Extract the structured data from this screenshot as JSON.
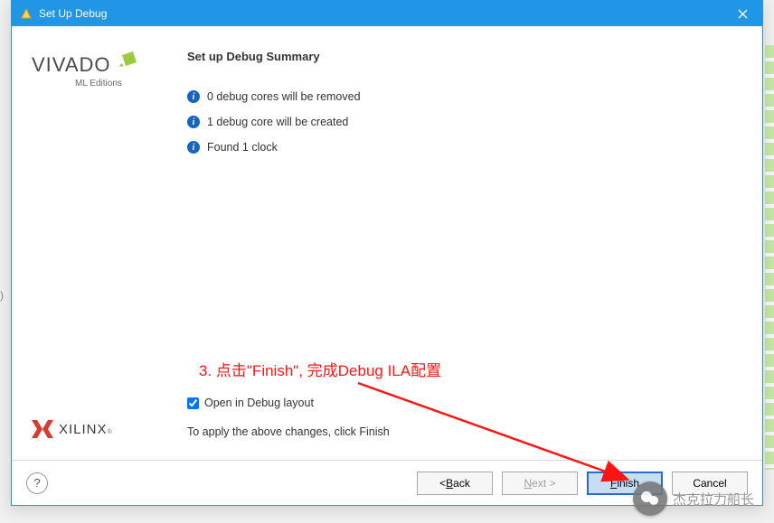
{
  "window": {
    "title": "Set Up Debug"
  },
  "sidebar": {
    "vivado_main": "VIVADO",
    "vivado_sub": "ML Editions",
    "xilinx": "XILINX"
  },
  "summary": {
    "heading": "Set up Debug Summary",
    "items": [
      "0 debug cores will be removed",
      "1 debug core will be created",
      "Found 1 clock"
    ]
  },
  "checkbox": {
    "label": "Open in Debug layout",
    "checked": true
  },
  "apply_text": "To apply the above changes, click Finish",
  "buttons": {
    "back": "< Back",
    "next": "Next >",
    "finish": "Finish",
    "cancel": "Cancel",
    "help": "?"
  },
  "annotation": {
    "text": "3. 点击\"Finish\", 完成Debug ILA配置"
  },
  "watermark": {
    "text": "杰克拉力船长"
  }
}
